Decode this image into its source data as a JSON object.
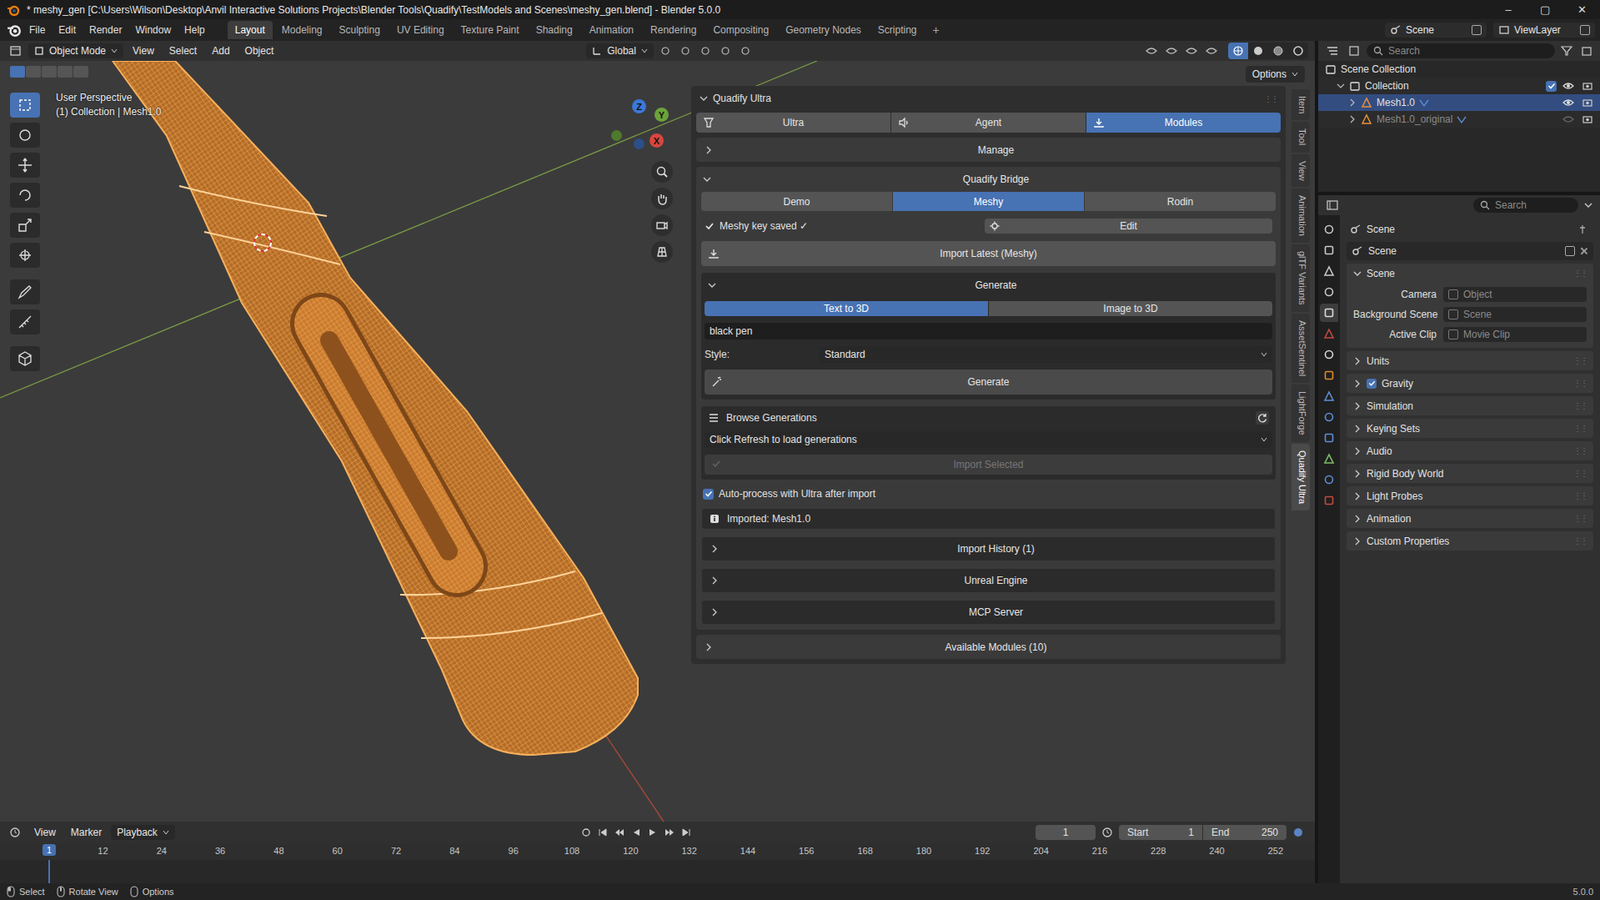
{
  "window": {
    "title": "* meshy_gen [C:\\Users\\Wilson\\Desktop\\Anvil Interactive Solutions Projects\\Blender Tools\\Quadify\\TestModels and Scenes\\meshy_gen.blend] - Blender 5.0.0",
    "controls": [
      "–",
      "▢",
      "✕"
    ]
  },
  "menus": [
    "File",
    "Edit",
    "Render",
    "Window",
    "Help"
  ],
  "workspaces": [
    {
      "label": "Layout",
      "selected": true
    },
    {
      "label": "Modeling",
      "selected": false
    },
    {
      "label": "Sculpting",
      "selected": false
    },
    {
      "label": "UV Editing",
      "selected": false
    },
    {
      "label": "Texture Paint",
      "selected": false
    },
    {
      "label": "Shading",
      "selected": false
    },
    {
      "label": "Animation",
      "selected": false
    },
    {
      "label": "Rendering",
      "selected": false
    },
    {
      "label": "Compositing",
      "selected": false
    },
    {
      "label": "Geometry Nodes",
      "selected": false
    },
    {
      "label": "Scripting",
      "selected": false
    }
  ],
  "workspace_add": "+",
  "scene_selector": "Scene",
  "view_layer": "ViewLayer",
  "viewport": {
    "mode": "Object Mode",
    "menus": [
      "View",
      "Select",
      "Add",
      "Object"
    ],
    "orientation": "Global",
    "options": "Options",
    "overlay_title": "User Perspective",
    "overlay_sub": "(1) Collection | Mesh1.0",
    "gizmo": [
      {
        "label": "Z",
        "color": "#3b78d8"
      },
      {
        "label": "Y",
        "color": "#6ca33a"
      },
      {
        "label": "X",
        "color": "#d8463f"
      }
    ]
  },
  "npanel": {
    "title": "Quadify Ultra",
    "tabs": [
      {
        "label": "Ultra",
        "selected": false
      },
      {
        "label": "Agent",
        "selected": false
      },
      {
        "label": "Modules",
        "selected": true
      }
    ],
    "sections_top": [
      {
        "label": "Manage",
        "expanded": false
      }
    ],
    "bridge": {
      "label": "Quadify Bridge",
      "expanded": true,
      "providers": [
        {
          "label": "Demo",
          "selected": false
        },
        {
          "label": "Meshy",
          "selected": true
        },
        {
          "label": "Rodin",
          "selected": false
        }
      ],
      "key": {
        "label": "Meshy key saved",
        "mark": "✓",
        "checked": true
      },
      "edit_button": "Edit",
      "import_latest": "Import Latest (Meshy)",
      "generate": {
        "label": "Generate",
        "expanded": true,
        "modes": [
          {
            "label": "Text to 3D",
            "selected": true
          },
          {
            "label": "Image to 3D",
            "selected": false
          }
        ],
        "prompt": "black pen",
        "style_label": "Style:",
        "style_value": "Standard",
        "button": "Generate"
      },
      "browse": {
        "label": "Browse Generations",
        "dropdown": "Click Refresh to load generations",
        "import_button": "Import Selected",
        "import_disabled": true
      },
      "auto_process": {
        "label": "Auto-process with Ultra after import",
        "checked": true
      },
      "info": "Imported: Mesh1.0",
      "subsections": [
        {
          "label": "Import History (1)",
          "expanded": false
        },
        {
          "label": "Unreal Engine",
          "expanded": false
        },
        {
          "label": "MCP Server",
          "expanded": false
        }
      ]
    },
    "sections_bottom": [
      {
        "label": "Available Modules (10)",
        "expanded": false
      }
    ]
  },
  "vtabs": [
    {
      "label": "Item",
      "selected": false
    },
    {
      "label": "Tool",
      "selected": false
    },
    {
      "label": "View",
      "selected": false
    },
    {
      "label": "Animation",
      "selected": false
    },
    {
      "label": "glTF Variants",
      "selected": false
    },
    {
      "label": "AssetSentinel",
      "selected": false
    },
    {
      "label": "LightForge",
      "selected": false
    },
    {
      "label": "Quadify Ultra",
      "selected": true
    }
  ],
  "outliner": {
    "search": "Search",
    "rows": [
      {
        "label": "Scene Collection",
        "depth": 0,
        "kind": "scene",
        "selected": false,
        "dim": false
      },
      {
        "label": "Collection",
        "depth": 1,
        "kind": "collection",
        "selected": false,
        "dim": false
      },
      {
        "label": "Mesh1.0",
        "depth": 2,
        "kind": "mesh",
        "selected": true,
        "dim": false
      },
      {
        "label": "Mesh1.0_original",
        "depth": 2,
        "kind": "mesh",
        "selected": false,
        "dim": true
      }
    ]
  },
  "properties": {
    "search": "Search",
    "breadcrumb": "Scene",
    "datablock": "Scene",
    "panel": {
      "label": "Scene",
      "expanded": true,
      "fields": [
        {
          "label": "Camera",
          "value": "Object"
        },
        {
          "label": "Background Scene",
          "value": "Scene"
        },
        {
          "label": "Active Clip",
          "value": "Movie Clip"
        }
      ]
    },
    "subpanels": [
      {
        "label": "Units",
        "kind": "plain",
        "checked": false
      },
      {
        "label": "Gravity",
        "kind": "check",
        "checked": true
      },
      {
        "label": "Simulation",
        "kind": "plain",
        "checked": false
      },
      {
        "label": "Keying Sets",
        "kind": "plain",
        "checked": false
      },
      {
        "label": "Audio",
        "kind": "plain",
        "checked": false
      },
      {
        "label": "Rigid Body World",
        "kind": "plain",
        "checked": false
      },
      {
        "label": "Light Probes",
        "kind": "plain",
        "checked": false
      },
      {
        "label": "Animation",
        "kind": "plain",
        "checked": false
      },
      {
        "label": "Custom Properties",
        "kind": "plain",
        "checked": false
      }
    ]
  },
  "timeline": {
    "menus": [
      "View",
      "Marker"
    ],
    "playback": "Playback",
    "frame": "1",
    "start_label": "Start",
    "start": "1",
    "end_label": "End",
    "end": "250",
    "current": "1",
    "ticks": [
      "12",
      "24",
      "36",
      "48",
      "60",
      "72",
      "84",
      "96",
      "108",
      "120",
      "132",
      "144",
      "156",
      "168",
      "180",
      "192",
      "204",
      "216",
      "228",
      "240",
      "252"
    ]
  },
  "status_bar": {
    "items": [
      "Select",
      "Rotate View",
      "Options"
    ],
    "version": "5.0.0"
  }
}
